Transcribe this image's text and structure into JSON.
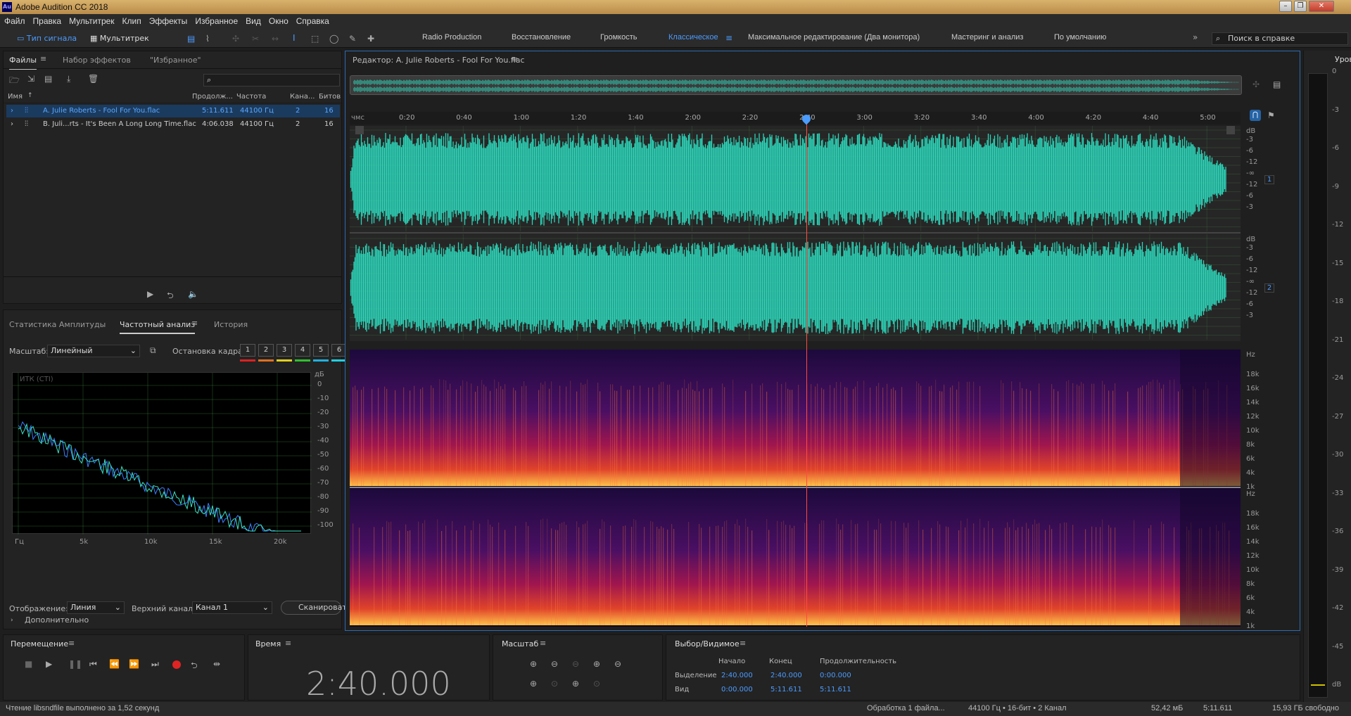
{
  "app": {
    "title": "Adobe Audition CC 2018",
    "logo": "Au"
  },
  "menu": [
    "Файл",
    "Правка",
    "Мультитрек",
    "Клип",
    "Эффекты",
    "Избранное",
    "Вид",
    "Окно",
    "Справка"
  ],
  "toolbar": {
    "waveform_label": "Тип сигнала",
    "multitrack_label": "Мультитрек",
    "workspaces": [
      "Radio Production",
      "Восстановление",
      "Громкость",
      "Классическое",
      "Максимальное редактирование (Два монитора)",
      "Мастеринг и анализ",
      "По умолчанию"
    ],
    "active_workspace": "Классическое",
    "search_placeholder": "Поиск в справке"
  },
  "files_panel": {
    "tabs": [
      "Файлы",
      "Набор эффектов",
      "\"Избранное\""
    ],
    "columns": [
      "Имя",
      "Продолж...",
      "Частота",
      "Кана...",
      "Битов"
    ],
    "files": [
      {
        "name": "A. Julie Roberts - Fool For You.flac",
        "duration": "5:11.611",
        "rate": "44100 Гц",
        "channels": "2",
        "bits": "16",
        "selected": true
      },
      {
        "name": "B. Juli...rts - It's Been A Long Long Time.flac",
        "duration": "4:06.038",
        "rate": "44100 Гц",
        "channels": "2",
        "bits": "16",
        "selected": false
      }
    ]
  },
  "analysis_panel": {
    "tabs": [
      "Статистика Амплитуды",
      "Частотный анализ",
      "История"
    ],
    "scale_label": "Масштаб:",
    "scale_value": "Линейный",
    "freeze_label": "Остановка кадра:",
    "freeze_buttons": [
      "1",
      "2",
      "3",
      "4",
      "5",
      "6"
    ],
    "freeze_colors": [
      "#e02020",
      "#e07020",
      "#e0d020",
      "#30c030",
      "#20b0e0",
      "#20d0e0"
    ],
    "graph_label": "ИТК (CTI)",
    "db_unit": "дБ",
    "db_ticks": [
      "0",
      "-10",
      "-20",
      "-30",
      "-40",
      "-50",
      "-60",
      "-70",
      "-80",
      "-90",
      "-100"
    ],
    "freq_ticks": [
      "Гц",
      "5k",
      "10k",
      "15k",
      "20k"
    ],
    "display_label": "Отображение:",
    "display_value": "Линия",
    "channel_label": "Верхний канал:",
    "channel_value": "Канал 1",
    "scan_label": "Сканировать",
    "more_label": "Дополнительно"
  },
  "editor": {
    "title": "Редактор: A. Julie Roberts - Fool For You.flac",
    "time_unit": "чмс",
    "ruler": [
      "0:20",
      "0:40",
      "1:00",
      "1:20",
      "1:40",
      "2:00",
      "2:20",
      "2:40",
      "3:00",
      "3:20",
      "3:40",
      "4:00",
      "4:20",
      "4:40",
      "5:00"
    ],
    "db_label": "dB",
    "db_scale": [
      "-3",
      "-6",
      "-12",
      "-∞",
      "-12",
      "-6",
      "-3"
    ],
    "channels": [
      "1",
      "2"
    ],
    "hz_label": "Hz",
    "hz_scale": [
      "18k",
      "16k",
      "14k",
      "12k",
      "10k",
      "8k",
      "6k",
      "4k",
      "1k"
    ],
    "wave_color": "#2dd4b8"
  },
  "levels": {
    "title": "Уровни",
    "ticks": [
      "0",
      "-3",
      "-6",
      "-9",
      "-12",
      "-15",
      "-18",
      "-21",
      "-24",
      "-27",
      "-30",
      "-33",
      "-36",
      "-39",
      "-42",
      "-45",
      "dB"
    ]
  },
  "transport": {
    "title": "Перемещение"
  },
  "time": {
    "title": "Время",
    "value": "2:40.000"
  },
  "zoom": {
    "title": "Масштаб"
  },
  "selection": {
    "title": "Выбор/Видимое",
    "headers": [
      "Начало",
      "Конец",
      "Продолжительность"
    ],
    "rows": [
      {
        "label": "Выделение",
        "start": "2:40.000",
        "end": "2:40.000",
        "duration": "0:00.000"
      },
      {
        "label": "Вид",
        "start": "0:00.000",
        "end": "5:11.611",
        "duration": "5:11.611"
      }
    ]
  },
  "status": {
    "left": "Чтение libsndfile выполнено за 1,52 секунд",
    "processing": "Обработка 1 файла...",
    "format": "44100 Гц • 16-бит • 2 Канал",
    "size": "52,42 мБ",
    "duration": "5:11.611",
    "free": "15,93 ГБ свободно"
  }
}
